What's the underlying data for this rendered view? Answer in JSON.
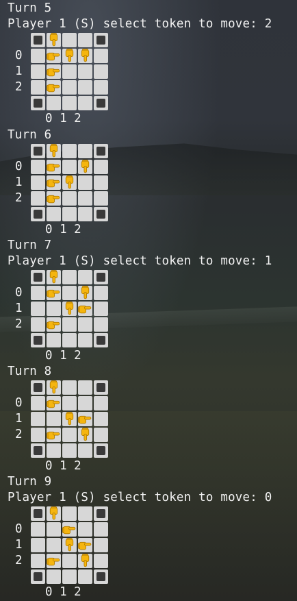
{
  "turns": [
    {
      "turn": "Turn 5",
      "prompt": "Player 1 (S) select token to move: 2",
      "rows": [
        {
          "label": "",
          "cells": [
            "corner",
            "down",
            "w",
            "w",
            "corner"
          ]
        },
        {
          "label": "0",
          "cells": [
            "w",
            "right",
            "down",
            "down",
            "w"
          ]
        },
        {
          "label": "1",
          "cells": [
            "w",
            "right",
            "w",
            "w",
            "w"
          ]
        },
        {
          "label": "2",
          "cells": [
            "w",
            "right",
            "w",
            "w",
            "w"
          ]
        },
        {
          "label": "",
          "cells": [
            "corner",
            "w",
            "w",
            "w",
            "corner"
          ]
        }
      ],
      "cols": "0 1 2"
    },
    {
      "turn": "Turn 6",
      "prompt": "",
      "rows": [
        {
          "label": "",
          "cells": [
            "corner",
            "down",
            "w",
            "w",
            "corner"
          ]
        },
        {
          "label": "0",
          "cells": [
            "w",
            "right",
            "w",
            "down",
            "w"
          ]
        },
        {
          "label": "1",
          "cells": [
            "w",
            "right",
            "down",
            "w",
            "w"
          ]
        },
        {
          "label": "2",
          "cells": [
            "w",
            "right",
            "w",
            "w",
            "w"
          ]
        },
        {
          "label": "",
          "cells": [
            "corner",
            "w",
            "w",
            "w",
            "corner"
          ]
        }
      ],
      "cols": "0 1 2"
    },
    {
      "turn": "Turn 7",
      "prompt": "Player 1 (S) select token to move: 1",
      "rows": [
        {
          "label": "",
          "cells": [
            "corner",
            "down",
            "w",
            "w",
            "corner"
          ]
        },
        {
          "label": "0",
          "cells": [
            "w",
            "right",
            "w",
            "down",
            "w"
          ]
        },
        {
          "label": "1",
          "cells": [
            "w",
            "w",
            "down",
            "right",
            "w"
          ]
        },
        {
          "label": "2",
          "cells": [
            "w",
            "right",
            "w",
            "w",
            "w"
          ]
        },
        {
          "label": "",
          "cells": [
            "corner",
            "w",
            "w",
            "w",
            "corner"
          ]
        }
      ],
      "cols": "0 1 2"
    },
    {
      "turn": "Turn 8",
      "prompt": "",
      "rows": [
        {
          "label": "",
          "cells": [
            "corner",
            "down",
            "w",
            "w",
            "corner"
          ]
        },
        {
          "label": "0",
          "cells": [
            "w",
            "right",
            "w",
            "w",
            "w"
          ]
        },
        {
          "label": "1",
          "cells": [
            "w",
            "w",
            "down",
            "right",
            "w"
          ]
        },
        {
          "label": "2",
          "cells": [
            "w",
            "right",
            "w",
            "down",
            "w"
          ]
        },
        {
          "label": "",
          "cells": [
            "corner",
            "w",
            "w",
            "w",
            "corner"
          ]
        }
      ],
      "cols": "0 1 2"
    },
    {
      "turn": "Turn 9",
      "prompt": "Player 1 (S) select token to move: 0",
      "rows": [
        {
          "label": "",
          "cells": [
            "corner",
            "down",
            "w",
            "w",
            "corner"
          ]
        },
        {
          "label": "0",
          "cells": [
            "w",
            "w",
            "right",
            "w",
            "w"
          ]
        },
        {
          "label": "1",
          "cells": [
            "w",
            "w",
            "down",
            "right",
            "w"
          ]
        },
        {
          "label": "2",
          "cells": [
            "w",
            "right",
            "w",
            "down",
            "w"
          ]
        },
        {
          "label": "",
          "cells": [
            "corner",
            "w",
            "w",
            "w",
            "corner"
          ]
        }
      ],
      "cols": "0 1 2"
    }
  ],
  "token_icons": {
    "down": "pointing-down-hand-icon",
    "right": "pointing-right-hand-icon"
  },
  "colors": {
    "text": "#f2f2f2",
    "cell": "#d7d7d7",
    "corner_mark": "#3a3a3a",
    "token": "#f5b50f"
  }
}
